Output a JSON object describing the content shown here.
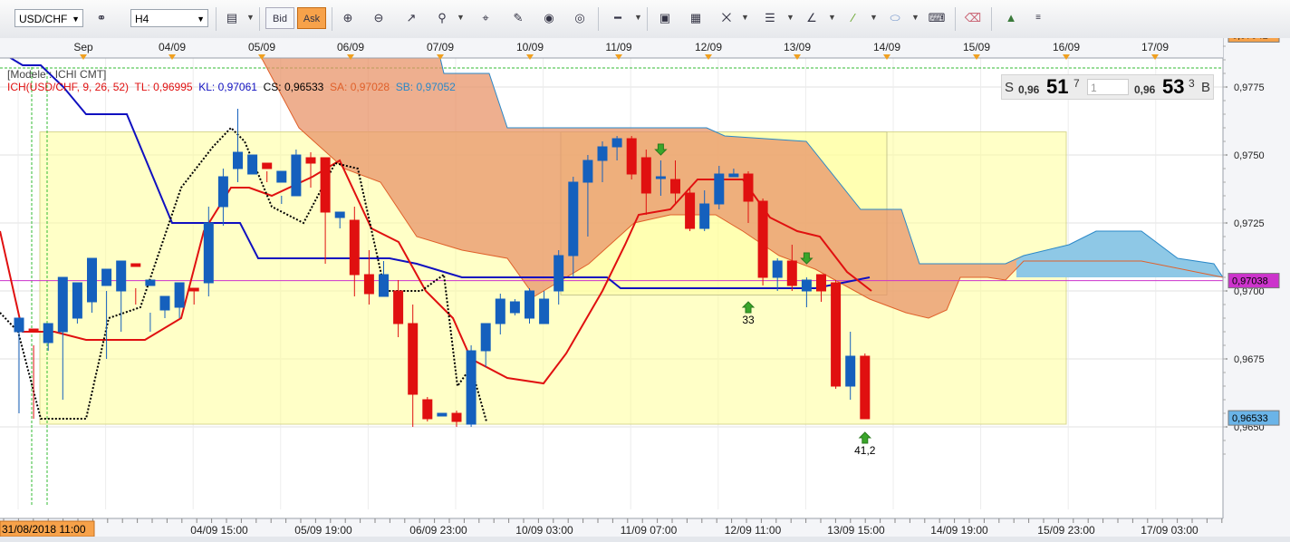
{
  "toolbar": {
    "symbol": "USD/CHF",
    "timeframe": "H4",
    "bid_label": "Bid",
    "ask_label": "Ask"
  },
  "legend": {
    "model": "[Modele : ICHI CMT]",
    "indicator": "ICH(USD/CHF, 9, 26, 52)",
    "tl": "TL: 0,96995",
    "kl": "KL: 0,97061",
    "cs": "CS: 0,96533",
    "sa": "SA: 0,97028",
    "sb": "SB: 0,97052"
  },
  "price_panel": {
    "sell_label": "S",
    "sell_prefix": "0,96",
    "sell_big": "51",
    "sell_sup": "7",
    "buy_prefix": "0,96",
    "buy_big": "53",
    "buy_sup": "3",
    "buy_label": "B",
    "input": "1"
  },
  "colors": {
    "bull": "#1560bd",
    "bear": "#e01010",
    "tenkan": "#e01010",
    "kijun": "#1010c0",
    "cloud_bear": "#e8946a",
    "cloud_bull": "#8ec8e6",
    "zone": "#ffff99",
    "hline": "#cc33cc"
  },
  "chart_data": {
    "type": "candlestick",
    "symbol": "USD/CHF",
    "timeframe": "H4",
    "ylim": [
      0.963,
      0.98
    ],
    "y_ticks": [
      "0,9650",
      "0,9675",
      "0,9700",
      "0,9725",
      "0,9750",
      "0,9775"
    ],
    "y_tick_values": [
      0.965,
      0.9675,
      0.97,
      0.9725,
      0.975,
      0.9775
    ],
    "top_labels": [
      "Sep",
      "04/09",
      "05/09",
      "06/09",
      "07/09",
      "10/09",
      "11/09",
      "12/09",
      "13/09",
      "14/09",
      "15/09",
      "16/09",
      "17/09"
    ],
    "bottom_labels": [
      "31/08/2018 11:00",
      "04/09 15:00",
      "05/09 19:00",
      "06/09 23:00",
      "10/09 03:00",
      "11/09 07:00",
      "12/09 11:00",
      "13/09 15:00",
      "14/09 19:00",
      "15/09 23:00",
      "17/09 03:00"
    ],
    "price_badges": [
      {
        "label": "0,97942",
        "value": 0.97942,
        "color": "#f7a24a"
      },
      {
        "label": "0,97038",
        "value": 0.97038,
        "color": "#cc33cc"
      },
      {
        "label": "0,96533",
        "value": 0.96533,
        "color": "#6ab4e8"
      }
    ],
    "horizontal_line": 0.97038,
    "candles": [
      [
        0.9685,
        0.969,
        0.9655,
        0.9685
      ],
      [
        0.9686,
        0.9685,
        0.9653,
        0.968
      ],
      [
        0.9681,
        0.9688,
        0.9678,
        0.9686
      ],
      [
        0.9685,
        0.9705,
        0.966,
        0.9702
      ],
      [
        0.969,
        0.9703,
        0.9688,
        0.9702
      ],
      [
        0.9696,
        0.9712,
        0.9692,
        0.971
      ],
      [
        0.9702,
        0.9708,
        0.9675,
        0.97
      ],
      [
        0.97,
        0.9711,
        0.9685,
        0.9709
      ],
      [
        0.971,
        0.9709,
        0.9695,
        0.9701
      ],
      [
        0.9702,
        0.9704,
        0.9685,
        0.9692
      ],
      [
        0.9693,
        0.9698,
        0.969,
        0.9697
      ],
      [
        0.9694,
        0.9703,
        0.969,
        0.9701
      ],
      [
        0.9701,
        0.97,
        0.9695,
        0.97
      ],
      [
        0.9703,
        0.9725,
        0.9698,
        0.9731
      ],
      [
        0.9731,
        0.9742,
        0.9724,
        0.9745
      ],
      [
        0.9745,
        0.9751,
        0.974,
        0.9767
      ],
      [
        0.9743,
        0.975,
        0.9749,
        0.9747
      ],
      [
        0.9747,
        0.9745,
        0.974,
        0.9744
      ],
      [
        0.974,
        0.9744,
        0.9732,
        0.9735
      ],
      [
        0.9735,
        0.975,
        0.9742,
        0.9752
      ],
      [
        0.9749,
        0.9747,
        0.9738,
        0.9751
      ],
      [
        0.9749,
        0.9729,
        0.971,
        0.9748
      ],
      [
        0.9727,
        0.9729,
        0.9723,
        0.9729
      ],
      [
        0.9726,
        0.9706,
        0.9698,
        0.9731
      ],
      [
        0.9706,
        0.9699,
        0.9695,
        0.9715
      ],
      [
        0.9698,
        0.9706,
        0.9698,
        0.9711
      ],
      [
        0.97,
        0.9688,
        0.9683,
        0.9704
      ],
      [
        0.9688,
        0.9662,
        0.965,
        0.9695
      ],
      [
        0.966,
        0.9653,
        0.9652,
        0.9661
      ],
      [
        0.9654,
        0.9655,
        0.9655,
        0.9655
      ],
      [
        0.9655,
        0.9652,
        0.965,
        0.9656
      ],
      [
        0.9651,
        0.9678,
        0.965,
        0.968
      ],
      [
        0.9678,
        0.9688,
        0.9672,
        0.968
      ],
      [
        0.9688,
        0.9697,
        0.9684,
        0.9699
      ],
      [
        0.9692,
        0.9696,
        0.9691,
        0.9697
      ],
      [
        0.969,
        0.97,
        0.9688,
        0.9701
      ],
      [
        0.9688,
        0.9697,
        0.9688,
        0.97
      ],
      [
        0.97,
        0.9713,
        0.9695,
        0.9715
      ],
      [
        0.9713,
        0.974,
        0.9705,
        0.9742
      ],
      [
        0.974,
        0.9748,
        0.972,
        0.975
      ],
      [
        0.9748,
        0.9753,
        0.974,
        0.9755
      ],
      [
        0.9753,
        0.9756,
        0.9748,
        0.9757
      ],
      [
        0.9756,
        0.9743,
        0.9741,
        0.9757
      ],
      [
        0.9749,
        0.9736,
        0.9728,
        0.9752
      ],
      [
        0.9742,
        0.9742,
        0.9735,
        0.9748
      ],
      [
        0.9741,
        0.9736,
        0.9732,
        0.9748
      ],
      [
        0.9736,
        0.9723,
        0.9722,
        0.9738
      ],
      [
        0.9723,
        0.9732,
        0.9722,
        0.9737
      ],
      [
        0.9732,
        0.9743,
        0.973,
        0.9746
      ],
      [
        0.9742,
        0.9743,
        0.9742,
        0.9745
      ],
      [
        0.9743,
        0.9733,
        0.9725,
        0.9744
      ],
      [
        0.9733,
        0.9705,
        0.9702,
        0.9734
      ],
      [
        0.9705,
        0.9711,
        0.97,
        0.9712
      ],
      [
        0.9711,
        0.9702,
        0.97,
        0.9717
      ],
      [
        0.97,
        0.9704,
        0.9694,
        0.9705
      ],
      [
        0.9706,
        0.97,
        0.9696,
        0.9705
      ],
      [
        0.9703,
        0.9665,
        0.9664,
        0.9704
      ],
      [
        0.9665,
        0.9676,
        0.966,
        0.9685
      ],
      [
        0.9676,
        0.9653,
        0.9653,
        0.9677
      ]
    ],
    "arrows": [
      {
        "index": 44,
        "price": 0.975,
        "dir": "down"
      },
      {
        "index": 50,
        "price": 0.9696,
        "dir": "up",
        "label": "33"
      },
      {
        "index": 54,
        "price": 0.971,
        "dir": "down"
      },
      {
        "index": 58,
        "price": 0.9648,
        "dir": "up",
        "label": "41,2"
      }
    ]
  }
}
